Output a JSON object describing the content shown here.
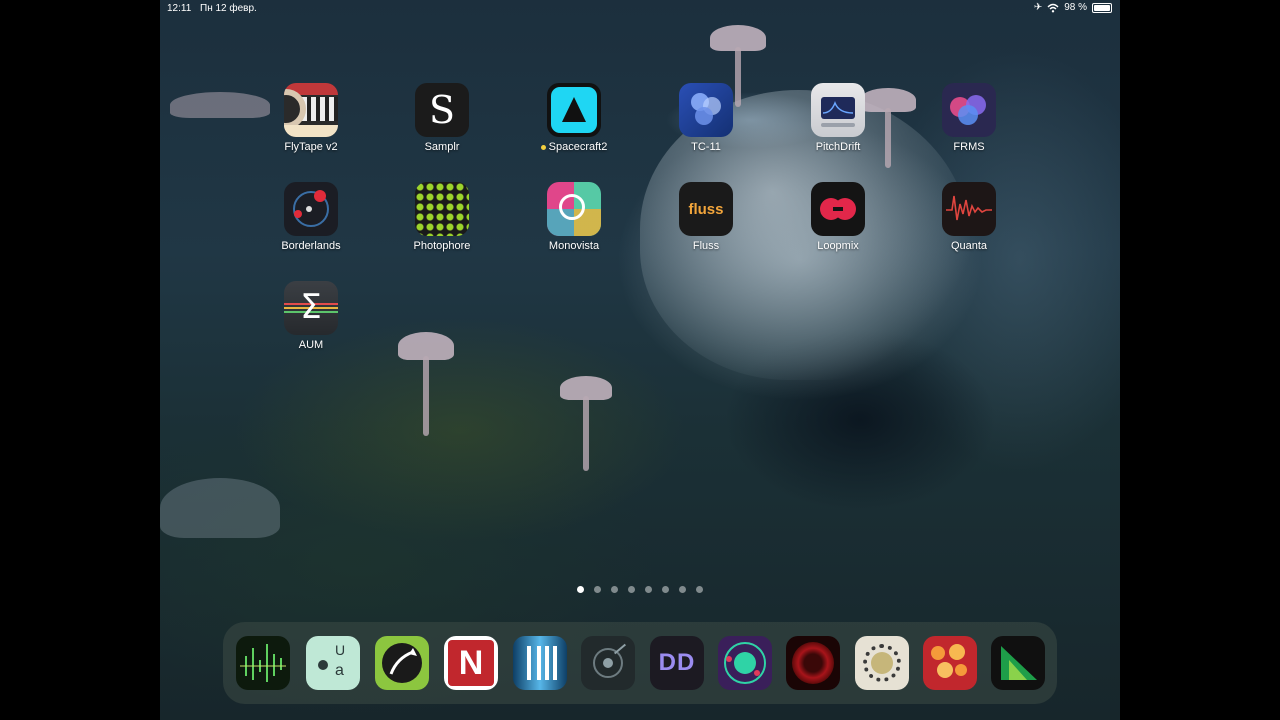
{
  "status_bar": {
    "time": "12:11",
    "date": "Пн 12 февр.",
    "battery": "98 %"
  },
  "apps": [
    {
      "label": "FlyTape v2",
      "icon": "flytape-icon"
    },
    {
      "label": "Samplr",
      "icon": "samplr-icon"
    },
    {
      "label": "Spacecraft2",
      "icon": "spacecraft-icon"
    },
    {
      "label": "TC-11",
      "icon": "tc11-icon"
    },
    {
      "label": "PitchDrift",
      "icon": "pitchdrift-icon"
    },
    {
      "label": "FRMS",
      "icon": "frms-icon"
    },
    {
      "label": "Borderlands",
      "icon": "borderlands-icon"
    },
    {
      "label": "Photophore",
      "icon": "photophore-icon"
    },
    {
      "label": "Monovista",
      "icon": "monovista-icon"
    },
    {
      "label": "Fluss",
      "icon": "fluss-icon"
    },
    {
      "label": "Loopmix",
      "icon": "loopmix-icon"
    },
    {
      "label": "Quanta",
      "icon": "quanta-icon"
    },
    {
      "label": "AUM",
      "icon": "aum-icon"
    }
  ],
  "icon_text": {
    "samplr": "S",
    "fluss": "fluss",
    "aum": "Σ",
    "dock_n": "N",
    "dock_ua_u": "U",
    "dock_ua_a": "a",
    "dock_dd": "DD"
  },
  "page_dots": {
    "count": 8,
    "active_index": 0
  },
  "dock": [
    "waveform-app-icon",
    "ua-app-icon",
    "arrow-swirl-app-icon",
    "n-app-icon",
    "rm-app-icon",
    "dial-app-icon",
    "dd-app-icon",
    "orbit-app-icon",
    "red-circle-app-icon",
    "gear-saw-app-icon",
    "red-dots-app-icon",
    "green-triangle-app-icon"
  ]
}
